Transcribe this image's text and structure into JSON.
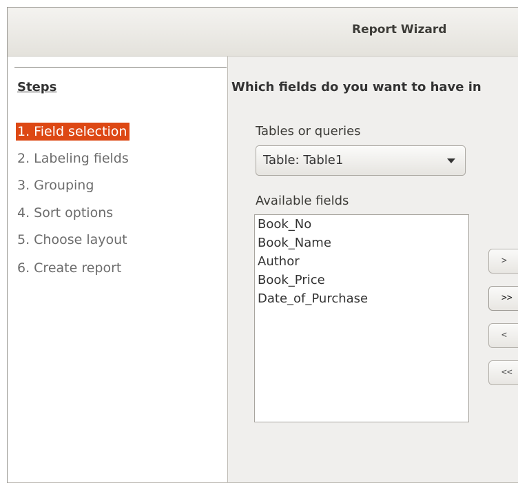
{
  "window": {
    "title": "Report Wizard"
  },
  "steps": {
    "heading": "Steps",
    "items": [
      {
        "label": "1. Field selection",
        "active": true
      },
      {
        "label": "2. Labeling fields",
        "active": false
      },
      {
        "label": "3. Grouping",
        "active": false
      },
      {
        "label": "4. Sort options",
        "active": false
      },
      {
        "label": "5. Choose layout",
        "active": false
      },
      {
        "label": "6. Create report",
        "active": false
      }
    ]
  },
  "main": {
    "question": "Which fields do you want to have in",
    "tables_label": "Tables or queries",
    "table_selected": "Table: Table1",
    "available_label": "Available fields",
    "available_fields": [
      "Book_No",
      "Book_Name",
      "Author",
      "Book_Price",
      "Date_of_Purchase"
    ],
    "buttons": {
      "add_one": ">",
      "add_all": ">>",
      "remove_one": "<",
      "remove_all": "<<"
    }
  },
  "colors": {
    "accent": "#dd4814"
  }
}
